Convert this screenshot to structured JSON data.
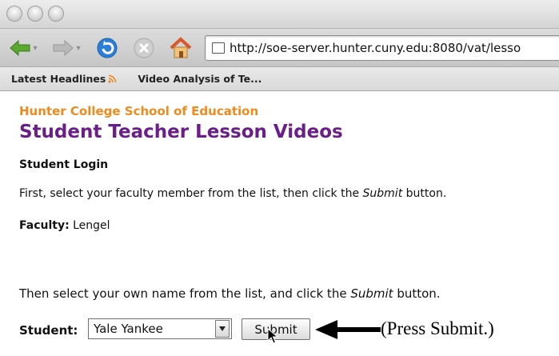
{
  "browser": {
    "url": "http://soe-server.hunter.cuny.edu:8080/vat/lesso",
    "bookmarks": [
      {
        "label": "Latest Headlines",
        "icon": "rss-icon"
      },
      {
        "label": "Video Analysis of Te..."
      }
    ]
  },
  "page": {
    "org": "Hunter College School of Education",
    "title": "Student Teacher Lesson Videos",
    "section_heading": "Student Login",
    "instruction1_pre": "First, select your faculty member from the list, then click the ",
    "instruction1_em": "Submit",
    "instruction1_post": " button.",
    "faculty_label": "Faculty:",
    "faculty_value": "Lengel",
    "instruction2_pre": "Then select your own name from the list, and click the ",
    "instruction2_em": "Submit",
    "instruction2_post": " button.",
    "student_label": "Student:",
    "student_selected": "Yale Yankee",
    "submit_label": "Submit"
  },
  "annotation": {
    "callout_text": "(Press Submit.)"
  },
  "colors": {
    "org": "#f08a1d",
    "title": "#6b1e8a",
    "back_arrow": "#5aa82e",
    "reload": "#2b7fd8",
    "home": "#d9582a"
  }
}
